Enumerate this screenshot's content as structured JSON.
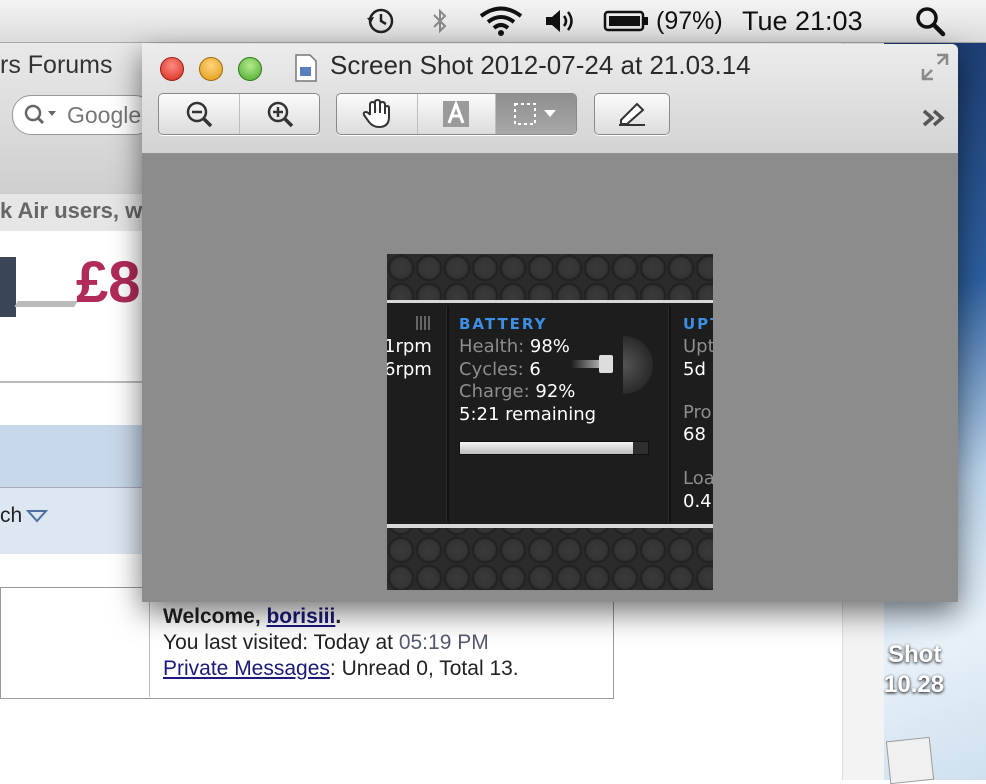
{
  "menubar": {
    "battery_percent": "(97%)",
    "clock": "Tue 21:03",
    "icons": [
      "time-machine-icon",
      "bluetooth-icon",
      "wifi-icon",
      "volume-icon",
      "battery-icon",
      "spotlight-icon"
    ]
  },
  "browser": {
    "title_fragment": "rs Forums",
    "search_placeholder": "Google",
    "banner_text": "k Air users, w",
    "ad_price": "£8",
    "search_fragment": "ch",
    "welcome_prefix": "Welcome, ",
    "username": "borisiii",
    "welcome_suffix": ".",
    "last_visited_prefix": "You last visited: Today at ",
    "last_visited_time": "05:19 PM",
    "pm_link": "Private Messages",
    "pm_counts": ": Unread 0, Total 13."
  },
  "desktop": {
    "icon_label_line1": "Shot",
    "icon_label_line2": "10.28"
  },
  "preview": {
    "title": "Screen Shot 2012-07-24 at 21.03.14",
    "toolbar": [
      "zoom-out",
      "zoom-in",
      "move",
      "text-select",
      "rect-select",
      "annotate"
    ]
  },
  "widget": {
    "left_col": [
      "1rpm",
      "6rpm"
    ],
    "battery": {
      "heading": "BATTERY",
      "health_label": "Health:",
      "health_value": "98%",
      "cycles_label": "Cycles:",
      "cycles_value": "6",
      "charge_label": "Charge:",
      "charge_value": "92%",
      "remaining": "5:21 remaining",
      "charge_fraction": 0.92
    },
    "uptime": {
      "heading": "UPT",
      "l1": "Upt",
      "v1": "5d",
      "l2": "Pro",
      "v2": "68",
      "l3": "Loa",
      "v3": "0.4"
    }
  }
}
